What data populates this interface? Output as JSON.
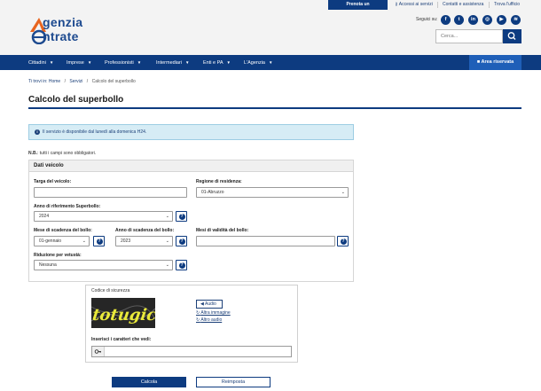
{
  "topbar": {
    "primary": "Prenota un appuntamento",
    "links": [
      "Accessi ai servizi",
      "Contatti e assistenza",
      "Trova l'ufficio"
    ]
  },
  "header": {
    "logo_line1": "genzia",
    "logo_line2": "ntrate",
    "social_label": "Seguici su:",
    "social_icons": [
      "facebook-icon",
      "twitter-icon",
      "linkedin-icon",
      "instagram-icon",
      "youtube-icon",
      "rss-icon"
    ],
    "search_placeholder": "Cerca..."
  },
  "nav": {
    "items": [
      "Cittadini",
      "Imprese",
      "Professionisti",
      "Intermediari",
      "Enti e PA",
      "L'Agenzia"
    ],
    "area_riservata": "Area riservata"
  },
  "breadcrumb": [
    "Ti trovi in: Home",
    "/",
    "Servizi",
    "/",
    "Calcolo del superbollo"
  ],
  "page_title": "Calcolo del superbollo",
  "alert_text": "Il servizio è disponibile dal lunedì alla domenica H24.",
  "nb": {
    "bold": "N.B.",
    "text": ": tutti i campi sono obbligatori."
  },
  "form": {
    "panel_title": "Dati veicolo",
    "targa_label": "Targa del veicolo:",
    "targa_value": "",
    "regione_label": "Regione di residenza:",
    "regione_value": "01-Abruzzo",
    "anno_rif_label": "Anno di riferimento Superbollo:",
    "anno_rif_value": "2024",
    "mese_label": "Mese di scadenza del bollo:",
    "mese_value": "01-gennaio",
    "anno_scad_label": "Anno di scadenza del bollo:",
    "anno_scad_value": "2023",
    "mesi_val_label": "Mesi di validità del bollo:",
    "mesi_val_value": "",
    "riduzione_label": "Riduzione per vetustà:",
    "riduzione_value": "Nessuna"
  },
  "captcha": {
    "legend": "Codice di sicurezza",
    "image_text": "totugica",
    "audio": "Audio",
    "altra_immagine": "Altra immagine",
    "altro_audio": "Altro audio",
    "input_label": "Inserisci i caratteri che vedi:"
  },
  "buttons": {
    "calcola": "Calcola",
    "reimposta": "Reimposta"
  },
  "colors": {
    "brand": "#0d3b80",
    "accent": "#1f5fb8",
    "alert_bg": "#d6ecf5"
  }
}
